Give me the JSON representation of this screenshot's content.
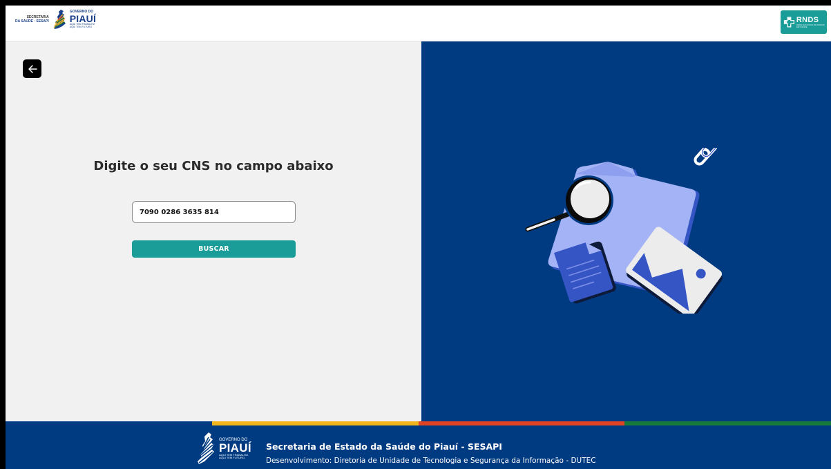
{
  "header": {
    "sesapi_line1": "SECRETARIA",
    "sesapi_line2": "DA SAÚDE · SESAPI",
    "gov_small": "GOVERNO DO",
    "gov_big": "PIAUÍ",
    "gov_slogan1": "AQUI TEM TRABALHO",
    "gov_slogan2": "AQUI TEM FUTURO",
    "rnds_title": "RNDS",
    "rnds_sub": "REDE NACIONAL DE DADOS EM SAÚDE"
  },
  "form": {
    "heading": "Digite o seu CNS no campo abaixo",
    "cns_value": "7090 0286 3635 814",
    "search_label": "BUSCAR"
  },
  "footer": {
    "gov_small": "GOVERNO DO",
    "gov_big": "PIAUÍ",
    "slogan1": "AQUI TEM TRABALHO.",
    "slogan2": "AQUI TEM FUTURO.",
    "title": "Secretaria de Estado da Saúde do Piauí - SESAPI",
    "subtitle": "Desenvolvimento: Diretoria de Unidade de Tecnologia e Segurança da Informação - DUTEC"
  },
  "colors": {
    "primary_blue": "#003b82",
    "teal": "#1a9c98",
    "stripe_yellow": "#f0b51b",
    "stripe_red": "#e04323",
    "stripe_green": "#177a3a"
  },
  "icons": [
    "arrow-left-icon",
    "magnifier-icon",
    "folder-icon",
    "document-icon",
    "image-icon",
    "chain-link-icon"
  ]
}
